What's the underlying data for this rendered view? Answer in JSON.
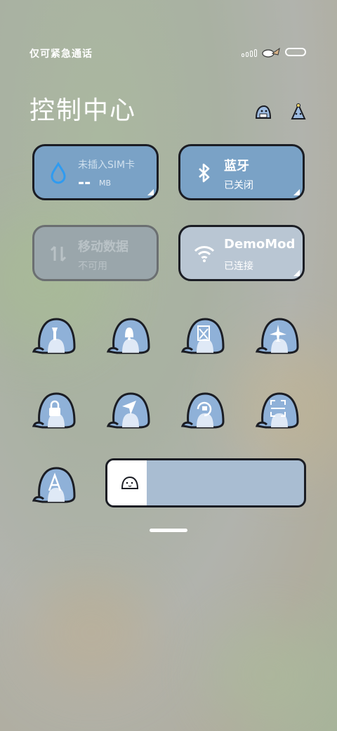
{
  "status": {
    "left_text": "仅可紧急通话"
  },
  "header": {
    "title": "控制中心"
  },
  "tiles": {
    "data_usage": {
      "label": "未插入SIM卡",
      "value": "--",
      "unit": "MB"
    },
    "bluetooth": {
      "label": "蓝牙",
      "status": "已关闭"
    },
    "mobile_data": {
      "label": "移动数据",
      "status": "不可用"
    },
    "wifi": {
      "label": "DemoMod",
      "status": "已连接"
    }
  },
  "toggles": [
    {
      "icon": "flashlight-icon"
    },
    {
      "icon": "bell-icon"
    },
    {
      "icon": "screenshot-icon"
    },
    {
      "icon": "airplane-icon"
    },
    {
      "icon": "lock-icon"
    },
    {
      "icon": "location-icon"
    },
    {
      "icon": "rotation-lock-icon"
    },
    {
      "icon": "scanner-icon"
    },
    {
      "icon": "auto-brightness-icon"
    }
  ],
  "brightness": {
    "level": 0.2
  },
  "colors": {
    "tile_blue": "#7aa2c6",
    "blob_blue": "#8fb1d8",
    "outline": "#1b1d24"
  }
}
